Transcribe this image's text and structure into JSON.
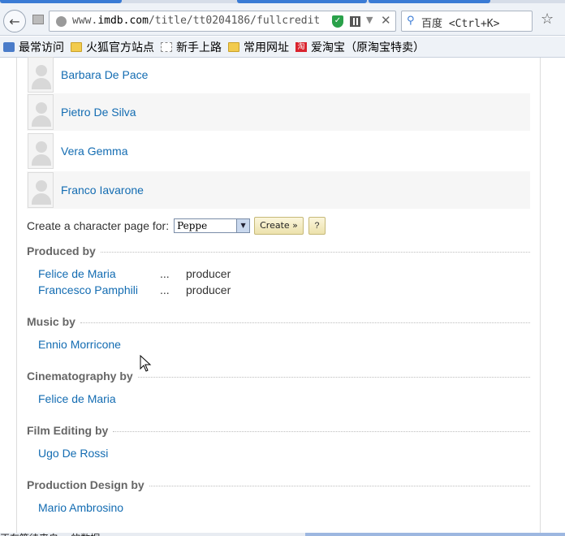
{
  "browser": {
    "url_prefix": "www.",
    "url_domain": "imdb.com",
    "url_path": "/title/tt0204186/fullcredit",
    "search_placeholder": "百度 <Ctrl+K>",
    "bookmarks": [
      {
        "label": "最常访问",
        "icon": "frequent-icon"
      },
      {
        "label": "火狐官方站点",
        "icon": "folder-icon"
      },
      {
        "label": "新手上路",
        "icon": "page-icon"
      },
      {
        "label": "常用网址",
        "icon": "folder-icon"
      },
      {
        "label": "爱淘宝（原淘宝特卖）",
        "icon": "taobao-icon",
        "glyph": "淘"
      }
    ],
    "status_text": "正在等待来自... 的数据..."
  },
  "cast": [
    {
      "name": "Barbara De Pace"
    },
    {
      "name": "Pietro De Silva"
    },
    {
      "name": "Vera Gemma"
    },
    {
      "name": "Franco Iavarone"
    }
  ],
  "character_page": {
    "label": "Create a character page for:",
    "selected": "Peppe",
    "create_label": "Create »",
    "help_label": "?"
  },
  "sections": [
    {
      "title": "Produced by",
      "credits": [
        {
          "name": "Felice de Maria",
          "dots": "...",
          "role": "producer"
        },
        {
          "name": "Francesco Pamphili",
          "dots": "...",
          "role": "producer"
        }
      ]
    },
    {
      "title": "Music by",
      "credits": [
        {
          "name": "Ennio Morricone"
        }
      ]
    },
    {
      "title": "Cinematography by",
      "credits": [
        {
          "name": "Felice de Maria"
        }
      ]
    },
    {
      "title": "Film Editing by",
      "credits": [
        {
          "name": "Ugo De Rossi"
        }
      ]
    },
    {
      "title": "Production Design by",
      "credits": [
        {
          "name": "Mario Ambrosino"
        }
      ]
    }
  ],
  "colors": {
    "link": "#136cb2",
    "section_heading": "#666666",
    "button_bg": "#ece2ac"
  }
}
